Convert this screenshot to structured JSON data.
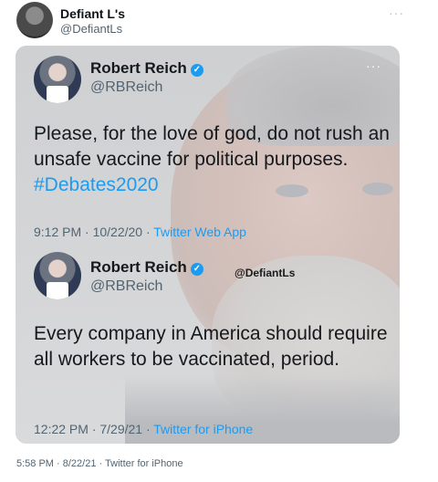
{
  "outer_tweet": {
    "display_name": "Defiant L's",
    "handle": "@DefiantLs",
    "more": "···",
    "timestamp": "5:58 PM · 8/22/21 · Twitter for iPhone"
  },
  "embedded_image": {
    "watermark": "@DefiantLs",
    "tweets": [
      {
        "display_name": "Robert Reich",
        "handle": "@RBReich",
        "more": "···",
        "text": "Please, for the love of god, do not rush an unsafe vaccine for political purposes.",
        "hashtag": "#Debates2020",
        "time_date": "9:12 PM · 10/22/20 · ",
        "source": "Twitter Web App"
      },
      {
        "display_name": "Robert Reich",
        "handle": "@RBReich",
        "more": "",
        "text": "Every company in America  should require all workers to be vaccinated, period.",
        "hashtag": "",
        "time_date": "12:22 PM · 7/29/21 · ",
        "source": "Twitter for iPhone"
      }
    ]
  },
  "colors": {
    "accent": "#1d9bf0",
    "secondary_text": "#536471",
    "primary_text": "#0f1419"
  }
}
